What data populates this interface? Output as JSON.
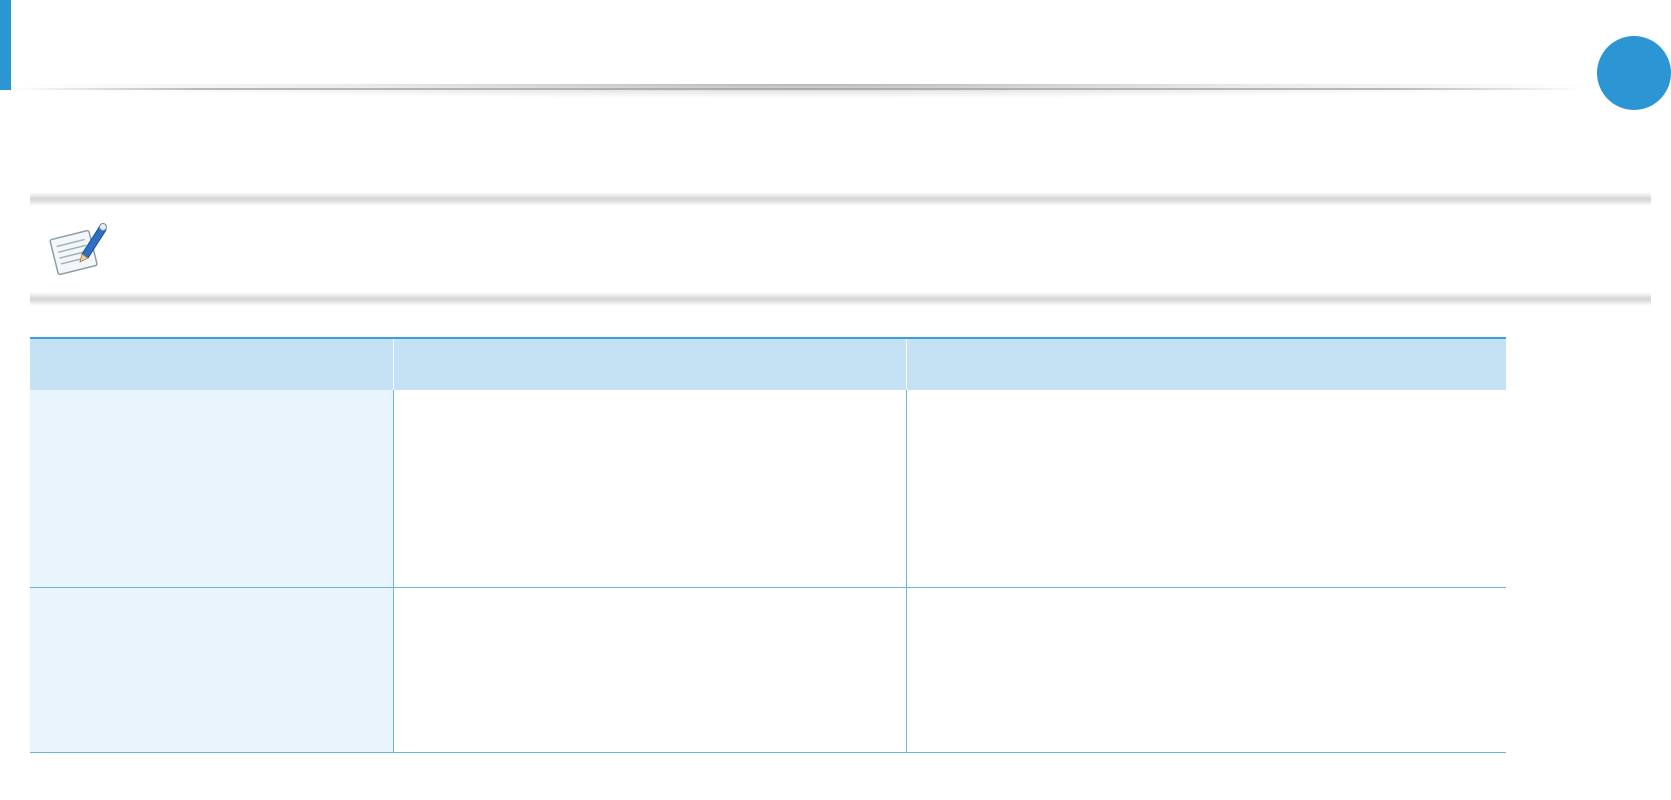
{
  "header": {
    "accent_color": "#2b96d3",
    "chapter_marker_color": "#2b96d3"
  },
  "note": {
    "icon": "note-pencil-icon",
    "text": ""
  },
  "table": {
    "header_color": "#c5e1f4",
    "first_column_color": "#eaf4fc",
    "border_color": "#3a9fd8",
    "columns": [
      "",
      "",
      ""
    ],
    "rows": [
      [
        "",
        "",
        ""
      ],
      [
        "",
        "",
        ""
      ]
    ]
  }
}
